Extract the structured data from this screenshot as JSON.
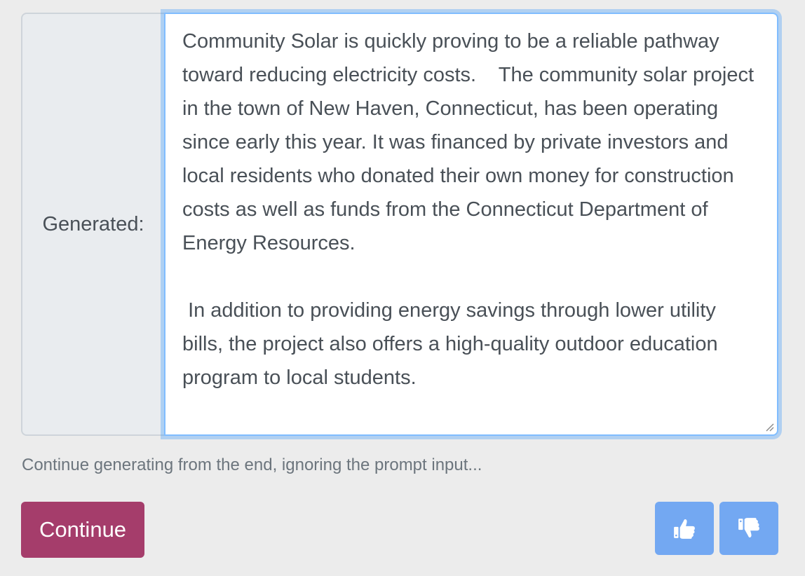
{
  "form": {
    "label": "Generated:",
    "generated_text": "Community Solar is quickly proving to be a reliable pathway toward reducing electricity costs.    The community solar project in the town of New Haven, Connecticut, has been operating since early this year. It was financed by private investors and local residents who donated their own money for construction costs as well as funds from the Connecticut Department of Energy Resources.\n\n In addition to providing energy savings through lower utility bills, the project also offers a high-quality outdoor education program to local students.",
    "helper_text": "Continue generating from the end, ignoring the prompt input..."
  },
  "actions": {
    "continue_label": "Continue",
    "thumbs_up_icon": "thumbs-up-icon",
    "thumbs_down_icon": "thumbs-down-icon"
  },
  "colors": {
    "continue_button": "#a53d6b",
    "vote_buttons": "#73a8f2",
    "focus_border": "#80bdff",
    "background": "#ececec"
  }
}
